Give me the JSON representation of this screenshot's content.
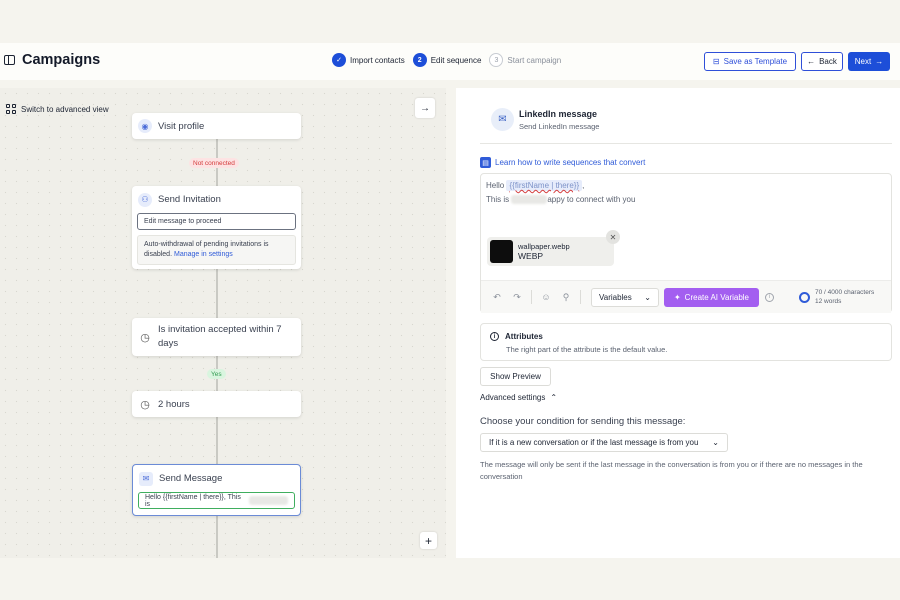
{
  "header": {
    "title": "Campaigns",
    "steps": [
      {
        "label": "Import contacts",
        "marker": "✓"
      },
      {
        "label": "Edit sequence",
        "marker": "2"
      },
      {
        "label": "Start campaign",
        "marker": "3"
      }
    ],
    "save_template": "Save as Template",
    "back": "Back",
    "next": "Next"
  },
  "canvas": {
    "switch_label": "Switch to advanced view",
    "nodes": {
      "visit": {
        "label": "Visit profile"
      },
      "not_connected": "Not connected",
      "invite": {
        "label": "Send Invitation",
        "field": "Edit message to proceed",
        "note": "Auto-withdrawal of pending invitations is disabled.",
        "note_link": "Manage in settings"
      },
      "accepted": {
        "label": "Is invitation accepted within 7 days"
      },
      "yes": "Yes",
      "wait": {
        "label": "2 hours"
      },
      "message": {
        "label": "Send Message",
        "field": "Hello {{firstName | there}}, This is"
      }
    }
  },
  "panel": {
    "title": "LinkedIn message",
    "subtitle": "Send LinkedIn message",
    "learn_link": "Learn how to write sequences that convert",
    "editor": {
      "hello": "Hello",
      "variable": "{{firstName | there}}",
      "comma": ",",
      "line2_start": "This is",
      "line2_end": "appy to connect with you",
      "attachment_name": "wallpaper.webp",
      "attachment_type": "WEBP",
      "variables_btn": "Variables",
      "ai_btn": "Create AI Variable",
      "char_count": "70 / 4000 characters",
      "word_count": "12 words"
    },
    "attributes_title": "Attributes",
    "attributes_sub": "The right part of the attribute is the default value.",
    "show_preview": "Show Preview",
    "advanced": "Advanced settings",
    "condition_label": "Choose your condition for sending this message:",
    "condition_value": "If it is a new conversation or if the last message is from you",
    "condition_note": "The message will only be sent if the last message in the conversation is from you or if there are no messages in the conversation"
  },
  "colors": {
    "accent": "#1d4ed8",
    "ai": "#a35ef0",
    "link": "#2f5bd8"
  }
}
